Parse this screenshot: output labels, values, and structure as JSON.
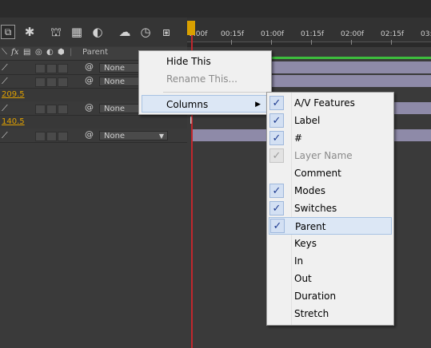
{
  "timeline": {
    "ticks": [
      "0:00f",
      "00:15f",
      "01:00f",
      "01:15f",
      "02:00f",
      "02:15f",
      "03:"
    ]
  },
  "columns_header": {
    "fx_label": "fx",
    "parent_label": "Parent"
  },
  "layers": [
    {
      "parent": "None"
    },
    {
      "parent": "None"
    },
    {
      "value": "209.5"
    },
    {
      "parent": "None"
    },
    {
      "value": "140.5"
    },
    {
      "parent": "None"
    }
  ],
  "context_menu": {
    "items": [
      {
        "label": "Hide This",
        "enabled": true
      },
      {
        "label": "Rename This...",
        "enabled": false
      },
      {
        "label": "Columns",
        "enabled": true,
        "submenu": true
      }
    ]
  },
  "columns_submenu": {
    "items": [
      {
        "label": "A/V Features",
        "checked": true,
        "enabled": true
      },
      {
        "label": "Label",
        "checked": true,
        "enabled": true
      },
      {
        "label": "#",
        "checked": true,
        "enabled": true
      },
      {
        "label": "Layer Name",
        "checked": true,
        "enabled": false
      },
      {
        "label": "Comment",
        "checked": false,
        "enabled": true
      },
      {
        "label": "Modes",
        "checked": true,
        "enabled": true
      },
      {
        "label": "Switches",
        "checked": true,
        "enabled": true
      },
      {
        "label": "Parent",
        "checked": true,
        "enabled": true,
        "highlighted": true
      },
      {
        "label": "Keys",
        "checked": false,
        "enabled": true
      },
      {
        "label": "In",
        "checked": false,
        "enabled": true
      },
      {
        "label": "Out",
        "checked": false,
        "enabled": true
      },
      {
        "label": "Duration",
        "checked": false,
        "enabled": true
      },
      {
        "label": "Stretch",
        "checked": false,
        "enabled": true
      }
    ],
    "check_glyph": "✓"
  },
  "colors": {
    "playhead": "#c0272d",
    "playhead_head": "#d9a000",
    "layer_bar": "#8e8aa8",
    "work_area": "#3dbd3d",
    "value_text": "#e0a100",
    "menu_highlight": "#dce7f5"
  },
  "icons": {
    "toolbar": [
      "composition-mini-flowchart-icon",
      "draft-3d-icon",
      "hide-shy-layers-icon",
      "frame-blending-icon",
      "motion-blur-icon",
      "brainstorm-icon",
      "auto-keyframe-icon",
      "graph-editor-icon"
    ]
  }
}
